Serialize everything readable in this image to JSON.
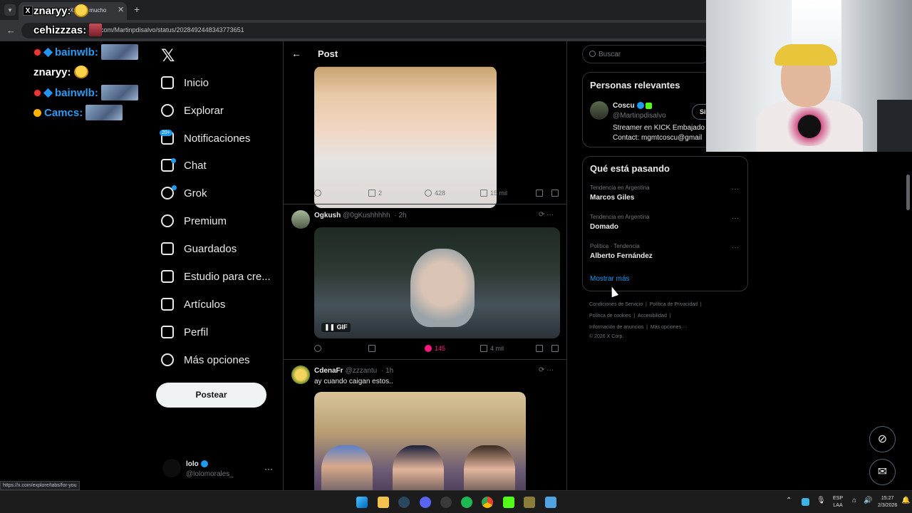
{
  "browser": {
    "tab_title": "X: \"C... mucho",
    "url": "x.com/Martinpdisalvo/status/2028492448343773651",
    "status_url": "https://x.com/explore/tabs/for-you"
  },
  "chat": [
    {
      "user": "znaryy:",
      "badges": [],
      "color": "#ffffff"
    },
    {
      "user": "cehizzzas:",
      "badges": [],
      "color": "#ffffff"
    },
    {
      "user": "bainwlb:",
      "badges": [
        "red",
        "blue"
      ],
      "color": "#2b9cf2"
    },
    {
      "user": "znaryy:",
      "badges": [],
      "color": "#ffffff"
    },
    {
      "user": "bainwlb:",
      "badges": [
        "red",
        "blue"
      ],
      "color": "#2b9cf2"
    },
    {
      "user": "Camcs:",
      "badges": [
        "orange"
      ],
      "color": "#2b9cf2"
    }
  ],
  "nav": {
    "items": [
      {
        "label": "Inicio",
        "icon": "home-icon"
      },
      {
        "label": "Explorar",
        "icon": "search-icon"
      },
      {
        "label": "Notificaciones",
        "icon": "bell-icon"
      },
      {
        "label": "Chat",
        "icon": "mail-icon"
      },
      {
        "label": "Grok",
        "icon": "grok-icon"
      },
      {
        "label": "Premium",
        "icon": "premium-icon"
      },
      {
        "label": "Guardados",
        "icon": "bookmark-icon"
      },
      {
        "label": "Estudio para cre...",
        "icon": "studio-icon"
      },
      {
        "label": "Artículos",
        "icon": "articles-icon"
      },
      {
        "label": "Perfil",
        "icon": "person-icon"
      },
      {
        "label": "Más opciones",
        "icon": "more-icon"
      }
    ],
    "notif_badge": "20+",
    "post_button": "Postear",
    "account_name": "lolo",
    "account_handle": "@lolomorales_"
  },
  "post_header": {
    "title": "Post"
  },
  "first_tweet_actions": {
    "retweets": "2",
    "likes": "428",
    "views": "15 mil"
  },
  "tweets": [
    {
      "name": "Ogkush",
      "handle": "@0gKushhhhh",
      "time": "· 2h",
      "media_tag": "GIF",
      "retweets": "",
      "likes": "145",
      "views": "4 mil"
    },
    {
      "name": "CdenaFr",
      "handle": "@zzzantu",
      "time": "· 1h",
      "text": "ay cuando caigan estos.."
    }
  ],
  "search": {
    "placeholder": "Buscar"
  },
  "relevant": {
    "title": "Personas relevantes",
    "name": "Coscu",
    "handle": "@Martinpdisalvo",
    "follow": "Si",
    "bio_line1": "Streamer en KICK Embajado",
    "bio_line2": "Contact: mgmtcoscu@gmail"
  },
  "trends": {
    "title": "Qué está pasando",
    "items": [
      {
        "meta": "Tendencia en Argentina",
        "name": "Marcos Giles"
      },
      {
        "meta": "Tendencia en Argentina",
        "name": "Domado"
      },
      {
        "meta": "Política · Tendencia",
        "name": "Alberto Fernández"
      }
    ],
    "show_more": "Mostrar más"
  },
  "footer": {
    "line1": [
      "Condiciones de Servicio",
      "Política de Privacidad"
    ],
    "line2": [
      "Política de cookies",
      "Accesibilidad"
    ],
    "line3": [
      "Información de anuncios",
      "Más opciones ···"
    ],
    "copyright": "© 2026 X Corp."
  },
  "taskbar": {
    "lang": "ESP",
    "layout": "LAA",
    "time": "15:27",
    "date": "2/3/2026"
  },
  "colors": {
    "accent": "#1d9bf0",
    "like": "#f91880",
    "background": "#000000"
  }
}
